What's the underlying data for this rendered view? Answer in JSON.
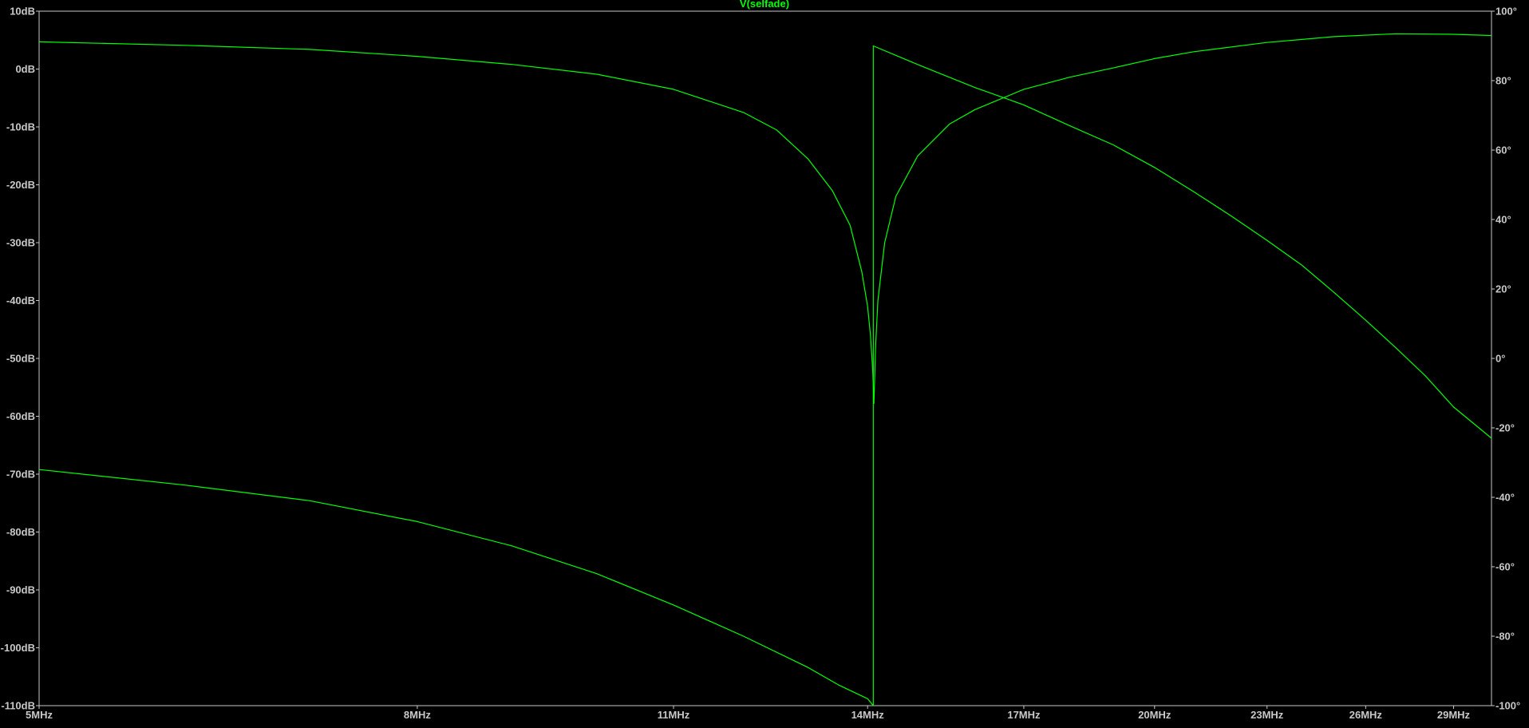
{
  "chart_data": {
    "type": "line",
    "title": "V(selfade)",
    "x_scale": "log",
    "xlim_mhz": [
      5,
      30.4
    ],
    "x_ticks": [
      {
        "value": 5,
        "label": "5MHz"
      },
      {
        "value": 8,
        "label": "8MHz"
      },
      {
        "value": 11,
        "label": "11MHz"
      },
      {
        "value": 14,
        "label": "14MHz"
      },
      {
        "value": 17,
        "label": "17MHz"
      },
      {
        "value": 20,
        "label": "20MHz"
      },
      {
        "value": 23,
        "label": "23MHz"
      },
      {
        "value": 26,
        "label": "26MHz"
      },
      {
        "value": 29,
        "label": "29MHz"
      }
    ],
    "y_left": {
      "unit": "dB",
      "ylim": [
        -110,
        10
      ],
      "ticks": [
        {
          "value": 10,
          "label": "10dB"
        },
        {
          "value": 0,
          "label": "0dB"
        },
        {
          "value": -10,
          "label": "-10dB"
        },
        {
          "value": -20,
          "label": "-20dB"
        },
        {
          "value": -30,
          "label": "-30dB"
        },
        {
          "value": -40,
          "label": "-40dB"
        },
        {
          "value": -50,
          "label": "-50dB"
        },
        {
          "value": -60,
          "label": "-60dB"
        },
        {
          "value": -70,
          "label": "-70dB"
        },
        {
          "value": -80,
          "label": "-80dB"
        },
        {
          "value": -90,
          "label": "-90dB"
        },
        {
          "value": -100,
          "label": "-100dB"
        },
        {
          "value": -110,
          "label": "-110dB"
        }
      ]
    },
    "y_right": {
      "unit": "degrees",
      "ylim": [
        -100,
        100
      ],
      "ticks": [
        {
          "value": 100,
          "label": "100°"
        },
        {
          "value": 80,
          "label": "80°"
        },
        {
          "value": 60,
          "label": "60°"
        },
        {
          "value": 40,
          "label": "40°"
        },
        {
          "value": 20,
          "label": "20°"
        },
        {
          "value": 0,
          "label": "0°"
        },
        {
          "value": -20,
          "label": "-20°"
        },
        {
          "value": -40,
          "label": "-40°"
        },
        {
          "value": -60,
          "label": "-60°"
        },
        {
          "value": -80,
          "label": "-80°"
        },
        {
          "value": -100,
          "label": "-100°"
        }
      ]
    },
    "series": [
      {
        "axis": "left",
        "color": "#00ff00",
        "points": [
          [
            5.0,
            4.7
          ],
          [
            6.0,
            4.1
          ],
          [
            7.0,
            3.4
          ],
          [
            8.0,
            2.2
          ],
          [
            9.0,
            0.8
          ],
          [
            10.0,
            -0.9
          ],
          [
            11.0,
            -3.5
          ],
          [
            12.0,
            -7.5
          ],
          [
            12.5,
            -10.5
          ],
          [
            13.0,
            -15.5
          ],
          [
            13.4,
            -21
          ],
          [
            13.7,
            -27
          ],
          [
            13.9,
            -35
          ],
          [
            14.0,
            -41
          ],
          [
            14.05,
            -46
          ],
          [
            14.09,
            -52
          ],
          [
            14.11,
            -57.8
          ],
          [
            14.14,
            -48
          ],
          [
            14.18,
            -40
          ],
          [
            14.3,
            -30
          ],
          [
            14.5,
            -22
          ],
          [
            14.9,
            -15
          ],
          [
            15.5,
            -9.5
          ],
          [
            16.0,
            -7
          ],
          [
            17.0,
            -3.5
          ],
          [
            18.0,
            -1.4
          ],
          [
            19.0,
            0.2
          ],
          [
            20.0,
            1.8
          ],
          [
            21.0,
            3.0
          ],
          [
            23.0,
            4.6
          ],
          [
            25.0,
            5.6
          ],
          [
            27.0,
            6.1
          ],
          [
            29.0,
            6.0
          ],
          [
            30.4,
            5.8
          ]
        ]
      },
      {
        "axis": "right",
        "color": "#00ff00",
        "points": [
          [
            5.0,
            -32
          ],
          [
            6.0,
            -36.5
          ],
          [
            7.0,
            -41
          ],
          [
            8.0,
            -47
          ],
          [
            9.0,
            -54
          ],
          [
            10.0,
            -62
          ],
          [
            11.0,
            -71
          ],
          [
            12.0,
            -80
          ],
          [
            13.0,
            -89
          ],
          [
            13.5,
            -94
          ],
          [
            14.0,
            -98
          ],
          [
            14.1,
            -100
          ],
          [
            14.1,
            90
          ],
          [
            15.0,
            84
          ],
          [
            16.0,
            78
          ],
          [
            17.0,
            73
          ],
          [
            18.0,
            67
          ],
          [
            19.0,
            61.5
          ],
          [
            20.0,
            55
          ],
          [
            21.0,
            48
          ],
          [
            22.0,
            41
          ],
          [
            23.0,
            34
          ],
          [
            24.0,
            27
          ],
          [
            25.0,
            19
          ],
          [
            26.0,
            11
          ],
          [
            27.0,
            3
          ],
          [
            28.0,
            -5
          ],
          [
            29.0,
            -14
          ],
          [
            30.4,
            -23
          ]
        ]
      }
    ]
  }
}
